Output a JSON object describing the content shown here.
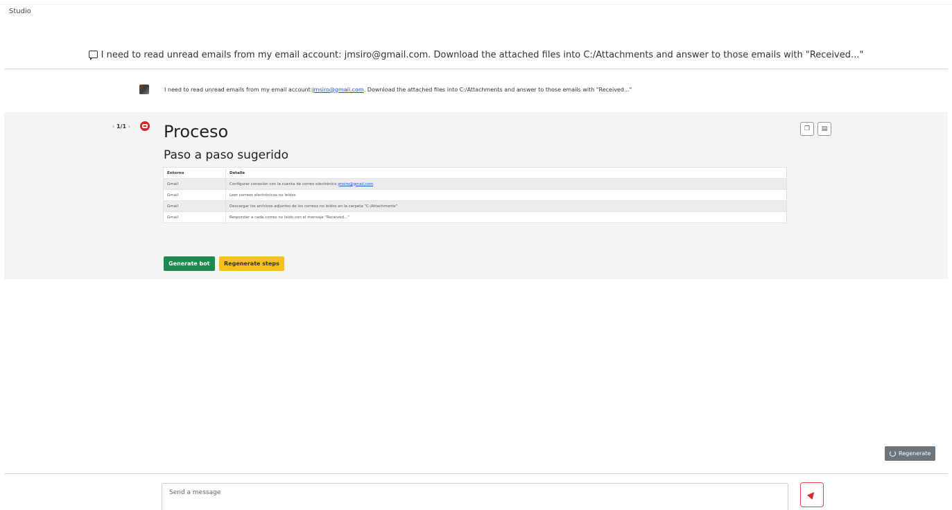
{
  "app": {
    "label": "Studio"
  },
  "conversation": {
    "title": "I need to read unread emails from my email account: jmsiro@gmail.com. Download the attached files into C:/Attachments and answer to those emails with \"Received...\""
  },
  "user_message": {
    "text_before": "I need to read unread emails from my email account: ",
    "link": "jmsiro@gmail.com",
    "text_after": ". Download the attached files into C:/Attachments and answer to those emails with \"Received...\""
  },
  "assistant": {
    "pager": {
      "prev": "‹",
      "current": "1/1",
      "next": "›"
    },
    "heading": "Proceso",
    "subheading": "Paso a paso sugerido",
    "table": {
      "headers": [
        "Entorno",
        "Detalle"
      ],
      "rows": [
        {
          "env": "Gmail",
          "detail": "Configurar conexión con la cuenta de correo electrónico ",
          "link": "jmsiro@gmail.com"
        },
        {
          "env": "Gmail",
          "detail": "Leer correos electrónicos no leídos"
        },
        {
          "env": "Gmail",
          "detail": "Descargar los archivos adjuntos de los correos no leídos en la carpeta \"C:/Attachments\""
        },
        {
          "env": "Gmail",
          "detail": "Responder a cada correo no leído con el mensaje \"Received...\""
        }
      ]
    },
    "buttons": {
      "generate_bot": "Generate bot",
      "regenerate_steps": "Regenerate steps"
    }
  },
  "footer": {
    "regenerate_label": "Regenerate",
    "input_placeholder": "Send a message"
  },
  "colors": {
    "accent_red": "#d92b2b",
    "generate_green": "#1e8a4f",
    "regenerate_yellow": "#f5c01a",
    "regen_gray": "#6c757d"
  }
}
